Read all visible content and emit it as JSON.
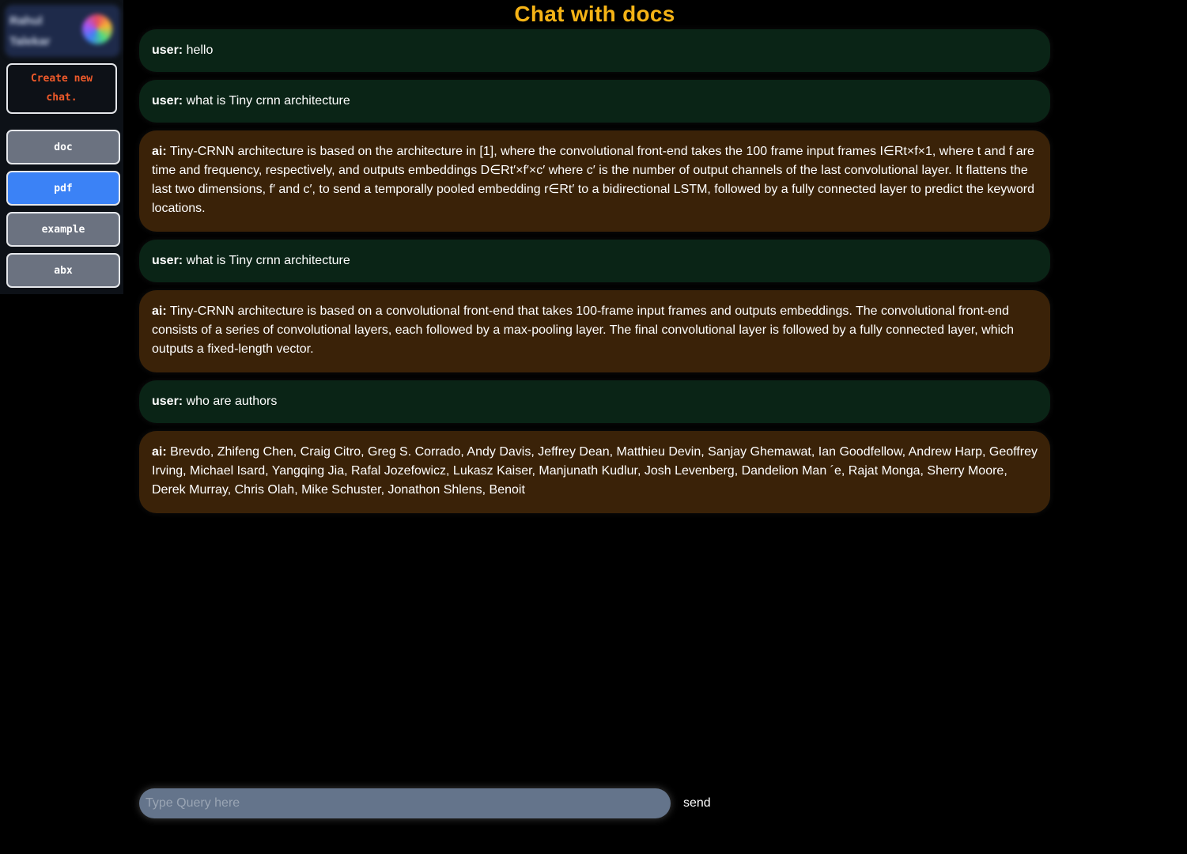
{
  "sidebar": {
    "profile_name": "Rahul Talekar",
    "new_chat_label": "Create new chat.",
    "chats": [
      {
        "label": "doc",
        "active": false
      },
      {
        "label": "pdf",
        "active": true
      },
      {
        "label": "example",
        "active": false
      },
      {
        "label": "abx",
        "active": false
      }
    ]
  },
  "header": {
    "title": "Chat with docs"
  },
  "messages": [
    {
      "role": "user:",
      "text": "hello"
    },
    {
      "role": "user:",
      "text": "what is Tiny crnn architecture"
    },
    {
      "role": "ai:",
      "text": "Tiny-CRNN architecture is based on the architecture in [1], where the convolutional front-end takes the 100 frame input frames I∈Rt×f×1, where t and f are time and frequency, respectively, and outputs embeddings D∈Rt′×f′×c′ where c′ is the number of output channels of the last convolutional layer. It flattens the last two dimensions, f′ and c′, to send a temporally pooled embedding r∈Rt′ to a bidirectional LSTM, followed by a fully connected layer to predict the keyword locations."
    },
    {
      "role": "user:",
      "text": "what is Tiny crnn architecture"
    },
    {
      "role": "ai:",
      "text": "Tiny-CRNN architecture is based on a convolutional front-end that takes 100-frame input frames and outputs embeddings. The convolutional front-end consists of a series of convolutional layers, each followed by a max-pooling layer. The final convolutional layer is followed by a fully connected layer, which outputs a fixed-length vector."
    },
    {
      "role": "user:",
      "text": "who are authors"
    },
    {
      "role": "ai:",
      "text": "Brevdo, Zhifeng Chen, Craig Citro, Greg S. Corrado, Andy Davis, Jeffrey Dean, Matthieu Devin, Sanjay Ghemawat, Ian Goodfellow, Andrew Harp, Geoffrey Irving, Michael Isard, Yangqing Jia, Rafal Jozefowicz, Lukasz Kaiser, Manjunath Kudlur, Josh Levenberg, Dandelion Man ´e, Rajat Monga, Sherry Moore, Derek Murray, Chris Olah, Mike Schuster, Jonathon Shlens, Benoit"
    }
  ],
  "composer": {
    "placeholder": "Type Query here",
    "value": "",
    "send_label": "send"
  }
}
